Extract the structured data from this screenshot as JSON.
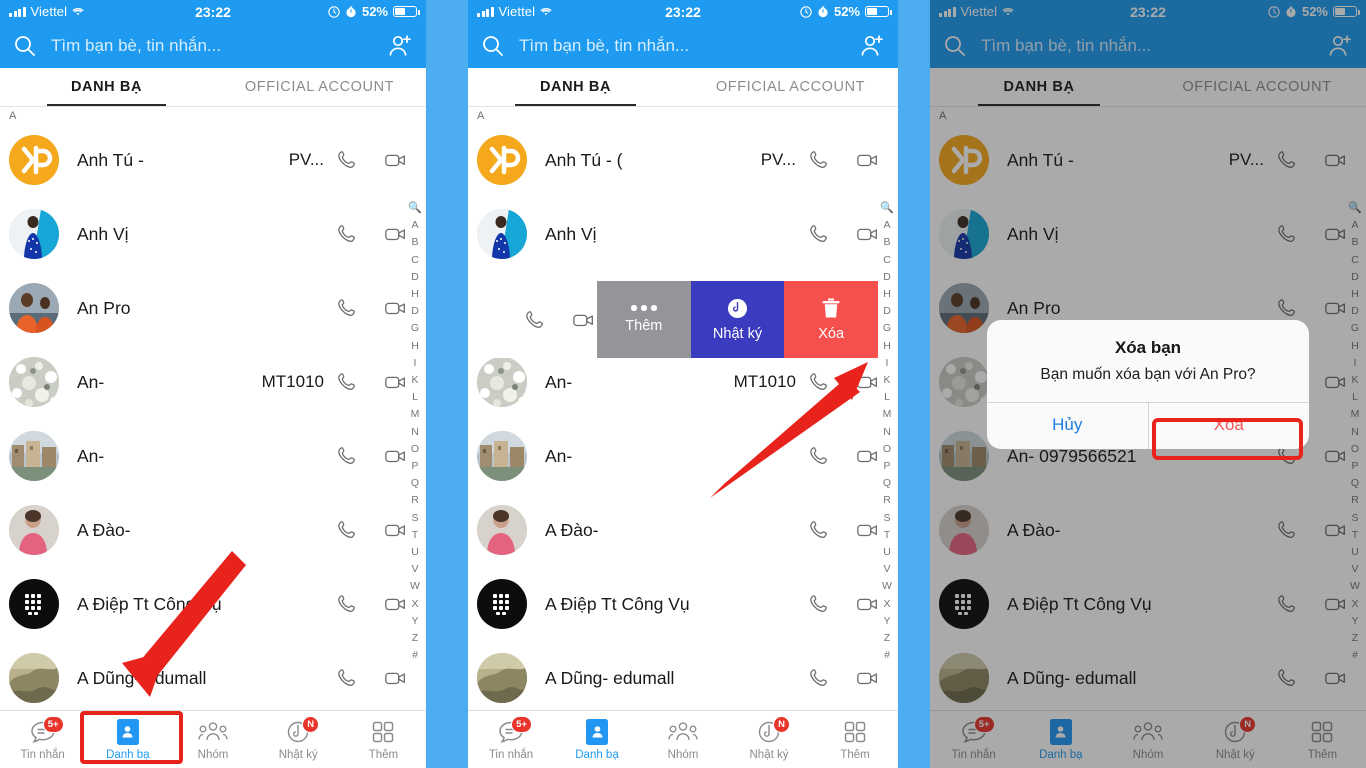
{
  "status_bar": {
    "carrier": "Viettel",
    "time": "23:22",
    "battery_percent": "52%",
    "icons": [
      "signal-bars-icon",
      "wifi-icon",
      "alarm-icon",
      "timer-icon",
      "battery-icon"
    ]
  },
  "search": {
    "placeholder": "Tìm bạn bè, tin nhắn...",
    "icon": "search-icon",
    "add_friend_icon": "add-friend-icon"
  },
  "tabs": {
    "items": [
      {
        "label": "DANH BẠ",
        "active": true
      },
      {
        "label": "OFFICIAL ACCOUNT",
        "active": false
      }
    ]
  },
  "section_letter": "A",
  "alphabet_index": [
    "A",
    "B",
    "C",
    "D",
    "H",
    "D",
    "G",
    "H",
    "I",
    "K",
    "L",
    "M",
    "N",
    "O",
    "P",
    "Q",
    "R",
    "S",
    "T",
    "U",
    "V",
    "W",
    "X",
    "Y",
    "Z",
    "#"
  ],
  "contacts": [
    {
      "name": "Anh Tú -",
      "name_alt": "Anh Tú - (",
      "sub": "PV...",
      "avatar": "kp-logo"
    },
    {
      "name": "Anh Vị",
      "name_alt": "Anh Vị",
      "sub": "",
      "avatar": "photo-boy-blue"
    },
    {
      "name": "An Pro",
      "name_alt": "An Pro",
      "sub": "",
      "avatar": "photo-orange-shirt"
    },
    {
      "name": "An-",
      "name_alt": "An-",
      "sub": "MT1010",
      "avatar": "photo-flowers"
    },
    {
      "name": "An-",
      "name_alt": "An-",
      "sub": "",
      "avatar": "photo-building"
    },
    {
      "name": "An- 0979566521",
      "name_alt": "An- 0979566521",
      "sub": "",
      "avatar": "photo-building"
    },
    {
      "name": "A Đào-",
      "name_alt": "A Đào-",
      "sub": "",
      "avatar": "photo-pink-child"
    },
    {
      "name": "A Điệp Tt Công Vụ",
      "name_alt": "A Điệp Tt Công Vụ",
      "sub": "",
      "avatar": "blackberry-logo"
    },
    {
      "name": "A Dũng- edumall",
      "name_alt": "A Dũng- edumall",
      "sub": "",
      "avatar": "photo-landscape"
    }
  ],
  "row_actions": {
    "call_icon": "phone-icon",
    "video_icon": "video-camera-icon"
  },
  "swipe_actions": [
    {
      "label": "Thêm",
      "icon": "ellipsis-icon",
      "color": "#939598"
    },
    {
      "label": "Nhật ký",
      "icon": "clock-icon",
      "color": "#3B3BBF"
    },
    {
      "label": "Xóa",
      "icon": "trash-can-icon",
      "color": "#F5504E"
    }
  ],
  "dialog": {
    "title": "Xóa bạn",
    "message": "Bạn muốn xóa bạn với An Pro?",
    "cancel_label": "Hủy",
    "confirm_label": "Xóa"
  },
  "bottom_tabs": [
    {
      "label": "Tin nhắn",
      "icon": "chat-bubble-icon",
      "badge": "5+",
      "active": false
    },
    {
      "label": "Danh bạ",
      "icon": "contact-card-icon",
      "badge": "",
      "active": true
    },
    {
      "label": "Nhóm",
      "icon": "people-group-icon",
      "badge": "",
      "active": false
    },
    {
      "label": "Nhật ký",
      "icon": "clock-icon",
      "badge": "N",
      "active": false
    },
    {
      "label": "Thêm",
      "icon": "grid-squares-icon",
      "badge": "",
      "active": false
    }
  ],
  "annotations": {
    "arrow1": "red-arrow-pointing-to-danh-ba-tab",
    "arrow2": "red-arrow-pointing-to-xoa-swipe-button",
    "highlight1": "red-box-around-danh-ba-tab",
    "highlight2": "red-box-around-xoa-dialog-button"
  },
  "colors": {
    "header_blue": "#1E9BF0",
    "gap_blue": "#4BADF0",
    "accent_red": "#E8231C",
    "delete_red": "#F5504E",
    "diary_blue": "#3B3BBF",
    "more_gray": "#939598"
  }
}
